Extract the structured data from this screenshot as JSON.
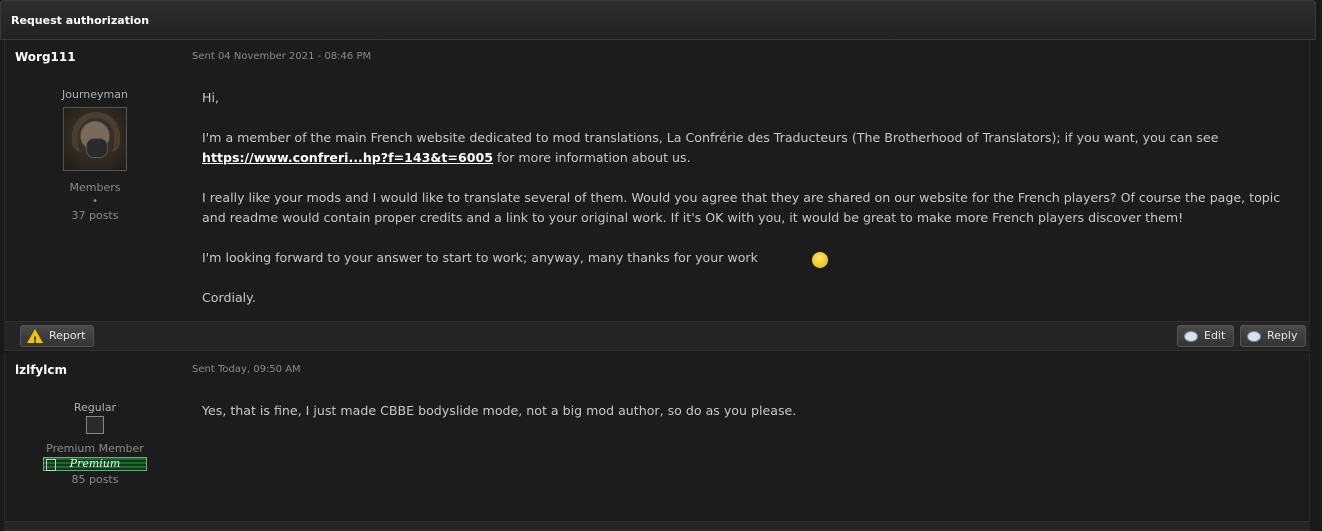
{
  "title": "Request authorization",
  "posts": [
    {
      "author": "Worg111",
      "sent": "Sent 04 November 2021 - 08:46 PM",
      "rank": "Journeyman",
      "group": "Members",
      "dot": "•",
      "posts": "37 posts",
      "paragraphs": {
        "p1": "Hi,",
        "p2a": "I'm a member of the main French website dedicated to mod translations, La Confrérie des Traducteurs (The Brotherhood of Translators); if you want, you can see ",
        "link": "https://www.confreri...hp?f=143&t=6005",
        "p2b": " for more information about us.",
        "p3": "I really like your mods and I would like to translate several of them. Would you agree that they are shared on our website for the French players? Of course the page, topic and readme would contain proper credits and a link to your original work. If it's OK with you, it would be great to make more French players discover them!",
        "p4": "I'm looking forward to your answer to start to work; anyway, many thanks for your work",
        "p5": "Cordialy."
      }
    },
    {
      "author": "lzlfylcm",
      "sent": "Sent Today, 09:50 AM",
      "rank": "Regular",
      "group": "Premium Member",
      "premium_label": "Premium",
      "posts": "85 posts",
      "body": "Yes, that is fine, I just made CBBE bodyslide mode, not a big mod author, so do as you please."
    }
  ],
  "actions": {
    "report": "Report",
    "edit": "Edit",
    "reply": "Reply"
  },
  "icons": {
    "report": "warning-icon",
    "edit": "edit-bubble-icon",
    "reply": "reply-bubble-icon",
    "smiley": "wink-smiley-icon"
  }
}
